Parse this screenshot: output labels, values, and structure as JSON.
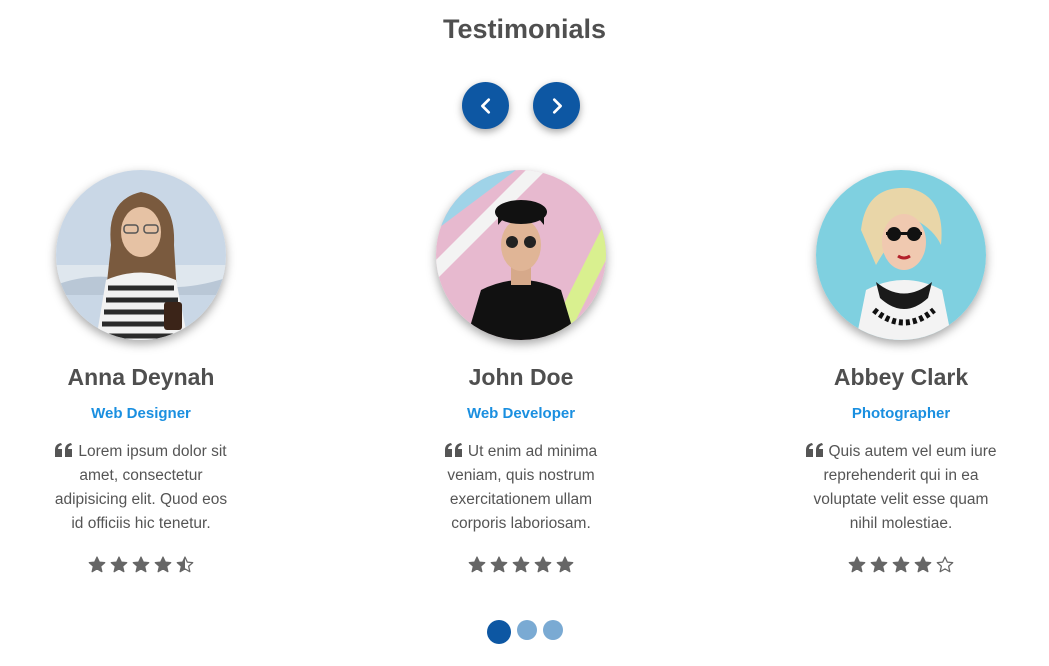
{
  "section": {
    "title": "Testimonials"
  },
  "nav": {
    "prev_icon": "chevron-left-icon",
    "next_icon": "chevron-right-icon"
  },
  "colors": {
    "accent": "#0d57a3",
    "role": "#1a8fe0",
    "dot_inactive": "#7aaad3",
    "text": "#4f4f4f"
  },
  "testimonials": [
    {
      "name": "Anna Deynah",
      "role": "Web Designer",
      "quote": "Lorem ipsum dolor sit amet, consectetur adipisicing elit. Quod eos id officiis hic tenetur.",
      "rating": 4.5
    },
    {
      "name": "John Doe",
      "role": "Web Developer",
      "quote": "Ut enim ad minima veniam, quis nostrum exercitationem ullam corporis laboriosam.",
      "rating": 5
    },
    {
      "name": "Abbey Clark",
      "role": "Photographer",
      "quote": "Quis autem vel eum iure reprehenderit qui in ea voluptate velit esse quam nihil molestiae.",
      "rating": 4
    }
  ],
  "pagination": {
    "total": 3,
    "active": 1
  }
}
